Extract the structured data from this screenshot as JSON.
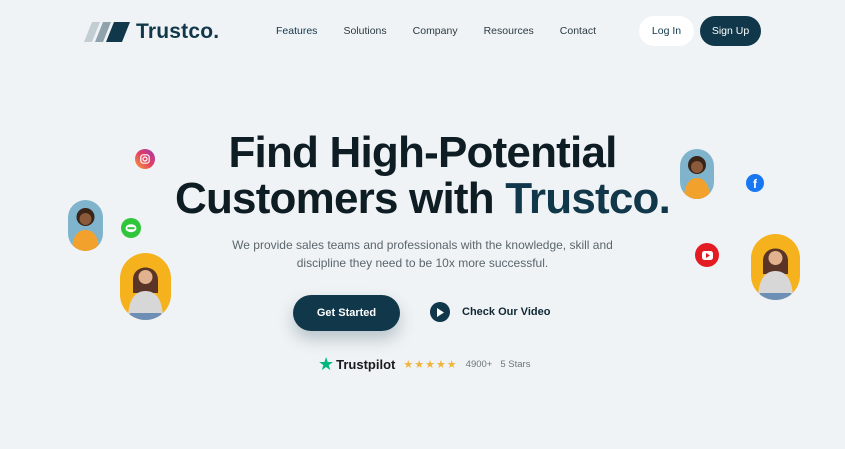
{
  "brand": {
    "name": "Trustco."
  },
  "nav": {
    "items": [
      {
        "label": "Features"
      },
      {
        "label": "Solutions"
      },
      {
        "label": "Company"
      },
      {
        "label": "Resources"
      },
      {
        "label": "Contact"
      }
    ],
    "login_label": "Log In",
    "signup_label": "Sign Up"
  },
  "hero": {
    "line1": "Find High-Potential",
    "line2_prefix": "Customers with ",
    "line2_accent": "Trustco.",
    "subtitle": "We provide sales teams and professionals with the knowledge, skill and discipline they need to be 10x more successful.",
    "cta_label": "Get Started",
    "video_label": "Check Our Video"
  },
  "rating": {
    "provider": "Trustpilot",
    "stars": 5,
    "count": "4900+",
    "label": "5 Stars"
  },
  "social_icons": [
    "instagram-icon",
    "line-icon",
    "facebook-icon",
    "youtube-icon"
  ],
  "colors": {
    "primary": "#11384a",
    "background": "#f0f3f5",
    "trustpilot": "#00b67a",
    "star": "#f0b43c"
  }
}
